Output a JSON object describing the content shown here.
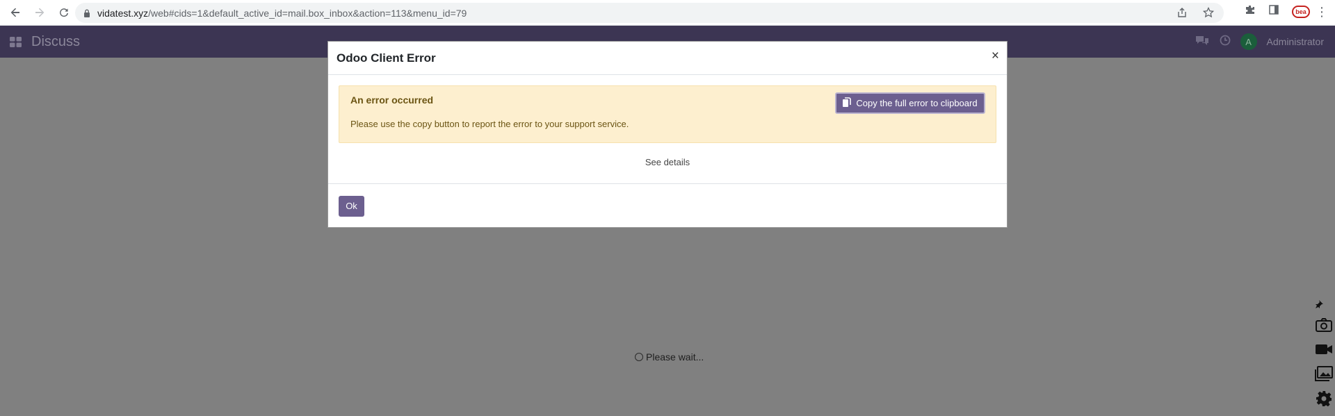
{
  "browser": {
    "url_host": "vidatest.xyz",
    "url_rest": "/web#cids=1&default_active_id=mail.box_inbox&action=113&menu_id=79",
    "profile_badge": "bea"
  },
  "navbar": {
    "app_name": "Discuss",
    "avatar_letter": "A",
    "user_name": "Administrator"
  },
  "dialog": {
    "title": "Odoo Client Error",
    "close_symbol": "×",
    "alert_heading": "An error occurred",
    "alert_text": "Please use the copy button to report the error to your support service.",
    "copy_button": "Copy the full error to clipboard",
    "see_details": "See details",
    "ok_button": "Ok"
  },
  "loading": {
    "text": "Please wait..."
  },
  "colors": {
    "odoo_purple": "#6c5f8f",
    "alert_bg": "#fdefcf",
    "alert_text": "#6b5413",
    "backdrop": "#808080"
  }
}
